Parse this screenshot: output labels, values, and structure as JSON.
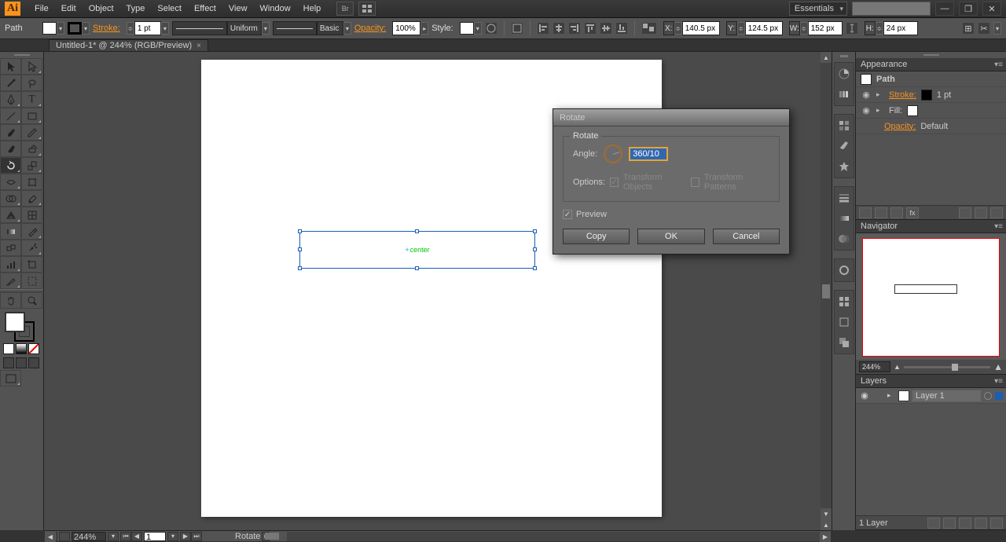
{
  "menu": {
    "items": [
      "File",
      "Edit",
      "Object",
      "Type",
      "Select",
      "Effect",
      "View",
      "Window",
      "Help"
    ],
    "br_label": "Br"
  },
  "workspace": "Essentials",
  "window_controls": {
    "min": "—",
    "max": "❐",
    "close": "✕"
  },
  "controlbar": {
    "selection_type": "Path",
    "stroke_label": "Stroke:",
    "stroke_weight": "1 pt",
    "stroke_profile": "Uniform",
    "brush": "Basic",
    "opacity_label": "Opacity:",
    "opacity": "100%",
    "style_label": "Style:",
    "x_label": "X:",
    "x": "140.5 px",
    "y_label": "Y:",
    "y": "124.5 px",
    "w_label": "W:",
    "w": "152 px",
    "h_label": "H:",
    "h": "24 px"
  },
  "doc_tab": "Untitled-1* @ 244% (RGB/Preview)",
  "canvas": {
    "selection_label": "center"
  },
  "dialog": {
    "title": "Rotate",
    "group": "Rotate",
    "angle_label": "Angle:",
    "angle_value": "360/10",
    "options_label": "Options:",
    "transform_objects": "Transform Objects",
    "transform_patterns": "Transform Patterns",
    "preview": "Preview",
    "copy": "Copy",
    "ok": "OK",
    "cancel": "Cancel"
  },
  "appearance": {
    "title": "Appearance",
    "item": "Path",
    "stroke": "Stroke:",
    "stroke_val": "1 pt",
    "fill": "Fill:",
    "opacity": "Opacity:",
    "opacity_val": "Default"
  },
  "navigator": {
    "title": "Navigator",
    "zoom": "244%"
  },
  "layers": {
    "title": "Layers",
    "layer_name": "Layer 1",
    "footer": "1 Layer"
  },
  "status": {
    "zoom": "244%",
    "artboard": "1",
    "tool": "Rotate"
  }
}
